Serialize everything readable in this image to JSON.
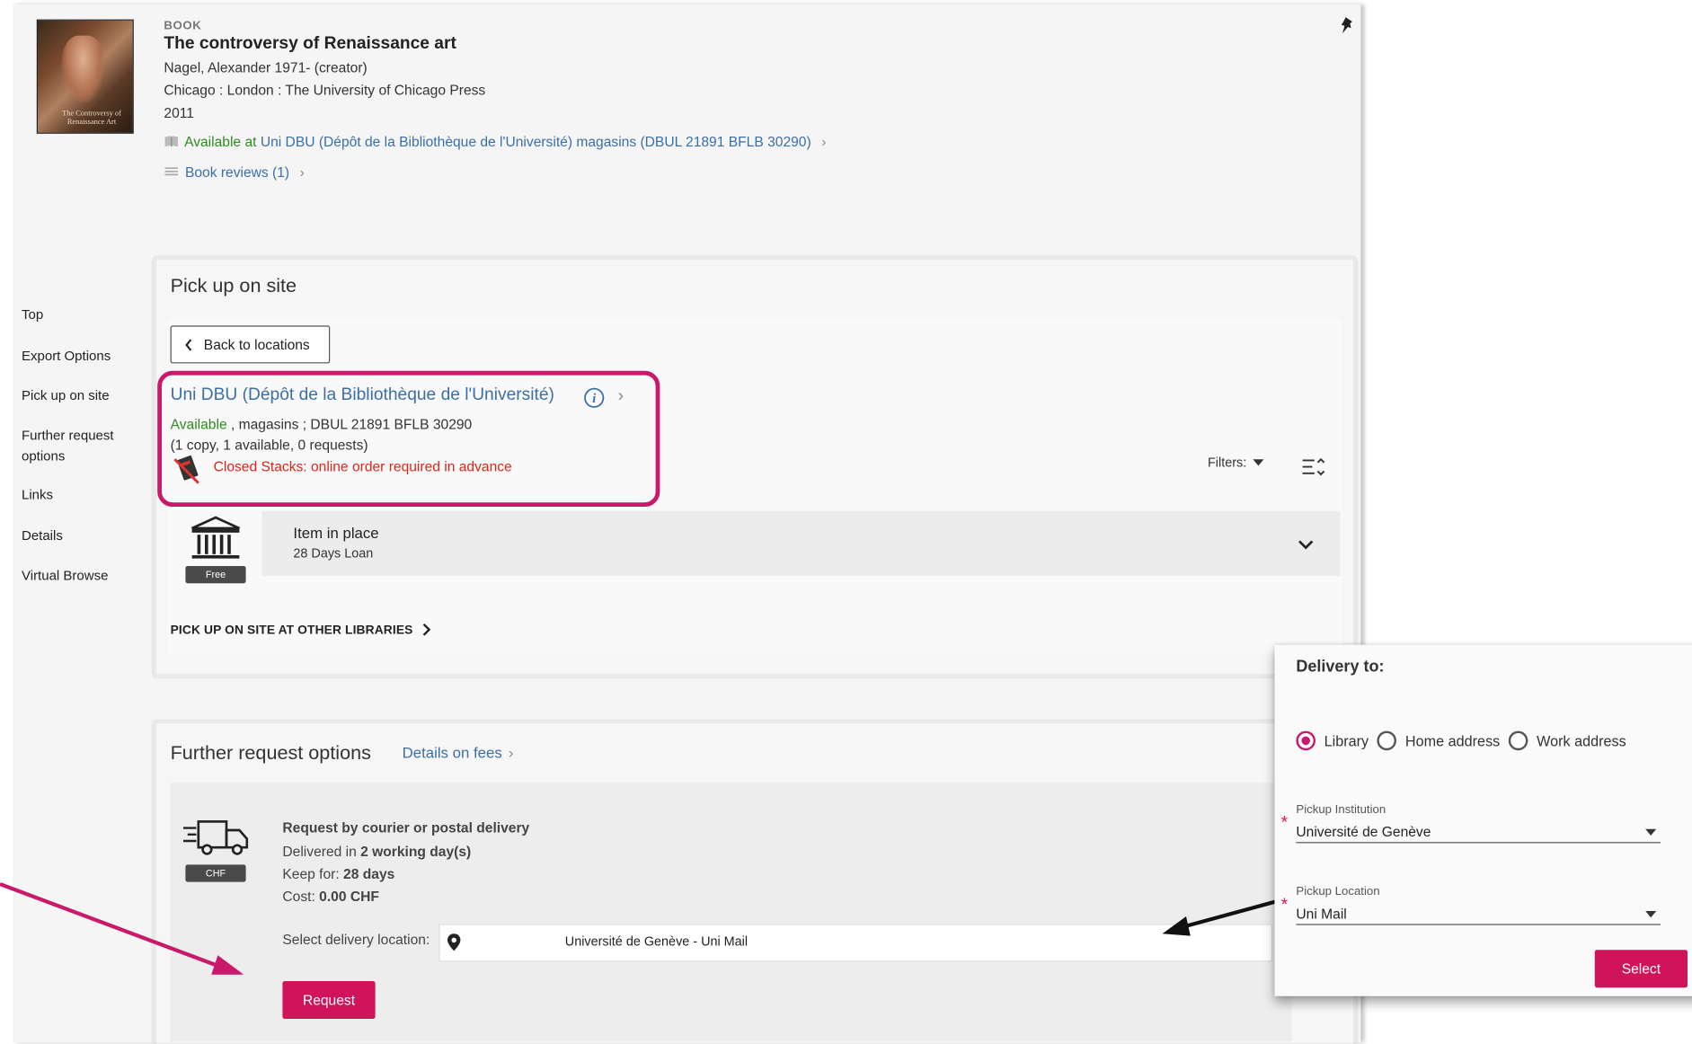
{
  "record": {
    "cover_text": "The Controversy of Renaissance Art",
    "type": "BOOK",
    "title": "The controversy of Renaissance art",
    "creator": "Nagel, Alexander 1971- (creator)",
    "publisher": "Chicago : London : The University of Chicago Press",
    "year": "2011",
    "availability_status": "Available at",
    "availability_location": "Uni DBU (Dépôt de la Bibliothèque de l'Université)  magasins (DBUL 21891 BFLB 30290)",
    "reviews_label": "Book reviews (1)"
  },
  "sidebar": {
    "items": [
      "Top",
      "Export Options",
      "Pick up on site",
      "Further request",
      "options",
      "Links",
      "Details",
      "Virtual Browse"
    ]
  },
  "pickup": {
    "title": "Pick up on site",
    "back_label": "Back to locations",
    "location_name": "Uni DBU (Dépôt de la Bibliothèque de l'Université)",
    "status": "Available",
    "shelf": " , magasins ; DBUL 21891 BFLB 30290",
    "copies": "(1 copy, 1 available, 0 requests)",
    "closed_note": "Closed Stacks: online order required in advance",
    "filters_label": "Filters:",
    "item_title": "Item in place",
    "item_loan": "28 Days Loan",
    "free_badge": "Free",
    "other_libraries": "PICK UP ON SITE AT OTHER LIBRARIES"
  },
  "further": {
    "title": "Further request options",
    "fees_link": "Details on fees",
    "chf_badge": "CHF",
    "request_title": "Request by courier or postal delivery",
    "delivered_prefix": "Delivered in ",
    "delivered_value": "2 working day(s)",
    "keep_prefix": "Keep for: ",
    "keep_value": "28 days",
    "cost_prefix": "Cost:  ",
    "cost_value": "0.00  CHF",
    "select_location_label": "Select delivery location:",
    "selected_location": "Université de Genève - Uni Mail",
    "request_button": "Request"
  },
  "delivery_popup": {
    "title": "Delivery to:",
    "options": [
      "Library",
      "Home address",
      "Work address"
    ],
    "selected_option": "Library",
    "institution_label": "Pickup Institution",
    "institution_value": "Université de Genève",
    "location_label": "Pickup Location",
    "location_value": "Uni Mail",
    "select_button": "Select"
  },
  "colors": {
    "accent": "#d1145a",
    "link": "#3b6fa8",
    "available": "#2e8b1f",
    "warning": "#e0241a",
    "annotation": "#c8196a"
  }
}
